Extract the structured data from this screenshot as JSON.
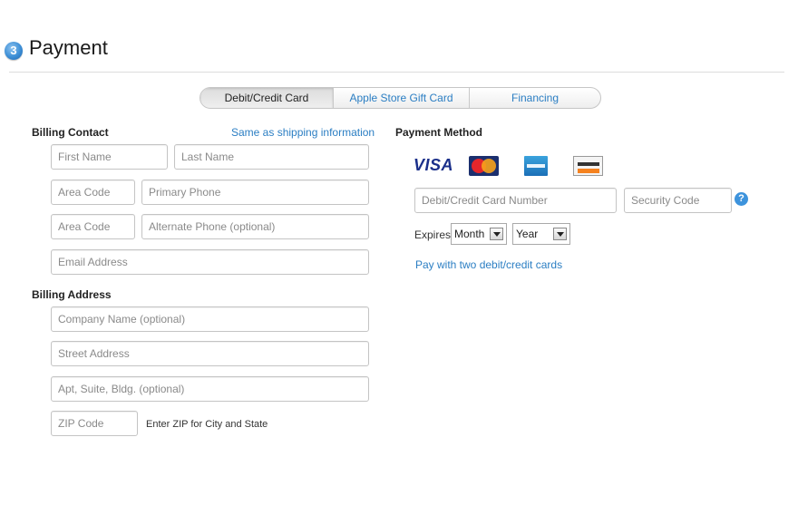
{
  "header": {
    "step_number": "3",
    "title": "Payment"
  },
  "tabs": [
    {
      "label": "Debit/Credit Card",
      "active": true
    },
    {
      "label": "Apple Store Gift Card",
      "active": false
    },
    {
      "label": "Financing",
      "active": false
    }
  ],
  "billing_contact": {
    "heading": "Billing Contact",
    "same_as_shipping_link": "Same as shipping information",
    "first_name_placeholder": "First Name",
    "last_name_placeholder": "Last Name",
    "area_code_placeholder": "Area Code",
    "primary_phone_placeholder": "Primary Phone",
    "alt_area_code_placeholder": "Area Code",
    "alternate_phone_placeholder": "Alternate Phone (optional)",
    "email_placeholder": "Email Address"
  },
  "billing_address": {
    "heading": "Billing Address",
    "company_placeholder": "Company Name (optional)",
    "street_placeholder": "Street Address",
    "apt_placeholder": "Apt, Suite, Bldg. (optional)",
    "zip_placeholder": "ZIP Code",
    "zip_hint": "Enter ZIP for City and State"
  },
  "payment_method": {
    "heading": "Payment Method",
    "card_logos": [
      "visa",
      "mastercard",
      "american-express",
      "discover"
    ],
    "visa_text": "VISA",
    "card_number_placeholder": "Debit/Credit Card Number",
    "security_code_placeholder": "Security Code",
    "help_icon_text": "?",
    "expires_label": "Expires",
    "month_value": "Month",
    "year_value": "Year",
    "two_cards_link": "Pay with two debit/credit cards"
  },
  "colors": {
    "link": "#2b7ec3",
    "step_badge": "#3d8fd6",
    "help_icon": "#3d93dc"
  }
}
